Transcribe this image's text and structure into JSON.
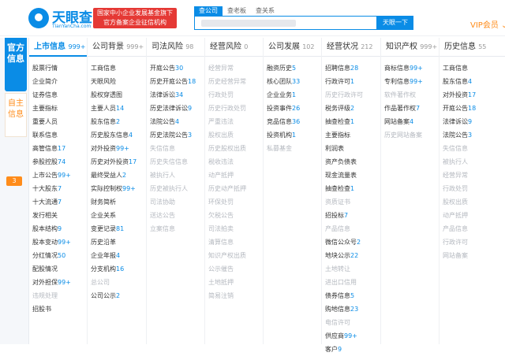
{
  "header": {
    "logo_text": "天眼查",
    "logo_sub": "TianYanCha.com",
    "badge_line1": "国家中小企业发展基金旗下",
    "badge_line2": "官方备案企业征信机构",
    "search_tabs": [
      "查公司",
      "查老板",
      "查关系"
    ],
    "search_button": "天眼一下",
    "vip": "VIP会员"
  },
  "sidebar": {
    "tab1": "官方信息",
    "tab2": "自主信息",
    "count": "3"
  },
  "columns": [
    {
      "title": "上市信息",
      "count": "999+",
      "items": [
        {
          "t": "股票行情",
          "c": "",
          "off": false
        },
        {
          "t": "企业简介",
          "c": "",
          "off": false
        },
        {
          "t": "证券信息",
          "c": "",
          "off": false
        },
        {
          "t": "主要指标",
          "c": "",
          "off": false
        },
        {
          "t": "重要人员",
          "c": "",
          "off": false
        },
        {
          "t": "联系信息",
          "c": "",
          "off": false
        },
        {
          "t": "高管信息",
          "c": "17",
          "off": false
        },
        {
          "t": "参股控股",
          "c": "74",
          "off": false
        },
        {
          "t": "上市公告",
          "c": "99+",
          "off": false
        },
        {
          "t": "十大股东",
          "c": "7",
          "off": false
        },
        {
          "t": "十大流通",
          "c": "7",
          "off": false
        },
        {
          "t": "发行相关",
          "c": "",
          "off": false
        },
        {
          "t": "股本结构",
          "c": "9",
          "off": false
        },
        {
          "t": "股本变动",
          "c": "99+",
          "off": false
        },
        {
          "t": "分红情况",
          "c": "50",
          "off": false
        },
        {
          "t": "配股情况",
          "c": "",
          "off": false
        },
        {
          "t": "对外担保",
          "c": "99+",
          "off": false
        },
        {
          "t": "违规处理",
          "c": "",
          "off": true
        },
        {
          "t": "招股书",
          "c": "",
          "off": false
        }
      ]
    },
    {
      "title": "公司背景",
      "count": "999+",
      "items": [
        {
          "t": "工商信息",
          "c": "",
          "off": false
        },
        {
          "t": "天眼风险",
          "c": "",
          "off": false
        },
        {
          "t": "股权穿透图",
          "c": "",
          "off": false
        },
        {
          "t": "主要人员",
          "c": "14",
          "off": false
        },
        {
          "t": "股东信息",
          "c": "2",
          "off": false
        },
        {
          "t": "历史股东信息",
          "c": "4",
          "off": false
        },
        {
          "t": "对外投资",
          "c": "99+",
          "off": false
        },
        {
          "t": "历史对外投资",
          "c": "17",
          "off": false
        },
        {
          "t": "最终受益人",
          "c": "2",
          "off": false
        },
        {
          "t": "实际控制权",
          "c": "99+",
          "off": false
        },
        {
          "t": "财务简析",
          "c": "",
          "off": false
        },
        {
          "t": "企业关系",
          "c": "",
          "off": false
        },
        {
          "t": "变更记录",
          "c": "81",
          "off": false
        },
        {
          "t": "历史沿革",
          "c": "",
          "off": false
        },
        {
          "t": "企业年报",
          "c": "4",
          "off": false
        },
        {
          "t": "分支机构",
          "c": "16",
          "off": false
        },
        {
          "t": "总公司",
          "c": "",
          "off": true
        },
        {
          "t": "公司公示",
          "c": "2",
          "off": false
        }
      ]
    },
    {
      "title": "司法风险",
      "count": "98",
      "items": [
        {
          "t": "开庭公告",
          "c": "30",
          "off": false
        },
        {
          "t": "历史开庭公告",
          "c": "18",
          "off": false
        },
        {
          "t": "法律诉讼",
          "c": "34",
          "off": false
        },
        {
          "t": "历史法律诉讼",
          "c": "9",
          "off": false
        },
        {
          "t": "法院公告",
          "c": "4",
          "off": false
        },
        {
          "t": "历史法院公告",
          "c": "3",
          "off": false
        },
        {
          "t": "失信信息",
          "c": "",
          "off": true
        },
        {
          "t": "历史失信信息",
          "c": "",
          "off": true
        },
        {
          "t": "被执行人",
          "c": "",
          "off": true
        },
        {
          "t": "历史被执行人",
          "c": "",
          "off": true
        },
        {
          "t": "司法协助",
          "c": "",
          "off": true
        },
        {
          "t": "送达公告",
          "c": "",
          "off": true
        },
        {
          "t": "立案信息",
          "c": "",
          "off": true
        }
      ]
    },
    {
      "title": "经营风险",
      "count": "0",
      "items": [
        {
          "t": "经营异常",
          "c": "",
          "off": true
        },
        {
          "t": "历史经营异常",
          "c": "",
          "off": true
        },
        {
          "t": "行政处罚",
          "c": "",
          "off": true
        },
        {
          "t": "历史行政处罚",
          "c": "",
          "off": true
        },
        {
          "t": "严重违法",
          "c": "",
          "off": true
        },
        {
          "t": "股权出质",
          "c": "",
          "off": true
        },
        {
          "t": "历史股权出质",
          "c": "",
          "off": true
        },
        {
          "t": "税收违法",
          "c": "",
          "off": true
        },
        {
          "t": "动产抵押",
          "c": "",
          "off": true
        },
        {
          "t": "历史动产抵押",
          "c": "",
          "off": true
        },
        {
          "t": "环保处罚",
          "c": "",
          "off": true
        },
        {
          "t": "欠税公告",
          "c": "",
          "off": true
        },
        {
          "t": "司法拍卖",
          "c": "",
          "off": true
        },
        {
          "t": "清算信息",
          "c": "",
          "off": true
        },
        {
          "t": "知识产权出质",
          "c": "",
          "off": true
        },
        {
          "t": "公示催告",
          "c": "",
          "off": true
        },
        {
          "t": "土地抵押",
          "c": "",
          "off": true
        },
        {
          "t": "简易注销",
          "c": "",
          "off": true
        }
      ]
    },
    {
      "title": "公司发展",
      "count": "102",
      "items": [
        {
          "t": "融资历史",
          "c": "5",
          "off": false
        },
        {
          "t": "核心团队",
          "c": "33",
          "off": false
        },
        {
          "t": "企业业务",
          "c": "1",
          "off": false
        },
        {
          "t": "投资事件",
          "c": "26",
          "off": false
        },
        {
          "t": "竞品信息",
          "c": "36",
          "off": false
        },
        {
          "t": "投资机构",
          "c": "1",
          "off": false
        },
        {
          "t": "私募基金",
          "c": "",
          "off": true
        }
      ]
    },
    {
      "title": "经营状况",
      "count": "212",
      "items": [
        {
          "t": "招聘信息",
          "c": "28",
          "off": false
        },
        {
          "t": "行政许可",
          "c": "1",
          "off": false
        },
        {
          "t": "历史行政许可",
          "c": "",
          "off": true
        },
        {
          "t": "税务评级",
          "c": "2",
          "off": false
        },
        {
          "t": "抽查检查",
          "c": "1",
          "off": false
        },
        {
          "t": "主要指标",
          "c": "",
          "off": false
        },
        {
          "t": "利润表",
          "c": "",
          "off": false
        },
        {
          "t": "资产负债表",
          "c": "",
          "off": false
        },
        {
          "t": "现金流量表",
          "c": "",
          "off": false
        },
        {
          "t": "抽查检查",
          "c": "1",
          "off": false
        },
        {
          "t": "资质证书",
          "c": "",
          "off": true
        },
        {
          "t": "招投标",
          "c": "7",
          "off": false
        },
        {
          "t": "产品信息",
          "c": "",
          "off": true
        },
        {
          "t": "微信公众号",
          "c": "2",
          "off": false
        },
        {
          "t": "地块公示",
          "c": "22",
          "off": false
        },
        {
          "t": "土地转让",
          "c": "",
          "off": true
        },
        {
          "t": "进出口信用",
          "c": "",
          "off": true
        },
        {
          "t": "债券信息",
          "c": "5",
          "off": false
        },
        {
          "t": "购地信息",
          "c": "23",
          "off": false
        },
        {
          "t": "电信许可",
          "c": "",
          "off": true
        },
        {
          "t": "供应商",
          "c": "99+",
          "off": false
        },
        {
          "t": "客户",
          "c": "9",
          "off": false
        }
      ]
    },
    {
      "title": "知识产权",
      "count": "999+",
      "items": [
        {
          "t": "商标信息",
          "c": "99+",
          "off": false
        },
        {
          "t": "专利信息",
          "c": "99+",
          "off": false
        },
        {
          "t": "软件著作权",
          "c": "",
          "off": true
        },
        {
          "t": "作品著作权",
          "c": "7",
          "off": false
        },
        {
          "t": "网站备案",
          "c": "4",
          "off": false
        },
        {
          "t": "历史网站备案",
          "c": "",
          "off": true
        }
      ]
    },
    {
      "title": "历史信息",
      "count": "55",
      "items": [
        {
          "t": "工商信息",
          "c": "",
          "off": false
        },
        {
          "t": "股东信息",
          "c": "4",
          "off": false
        },
        {
          "t": "对外投资",
          "c": "17",
          "off": false
        },
        {
          "t": "开庭公告",
          "c": "18",
          "off": false
        },
        {
          "t": "法律诉讼",
          "c": "9",
          "off": false
        },
        {
          "t": "法院公告",
          "c": "3",
          "off": false
        },
        {
          "t": "失信信息",
          "c": "",
          "off": true
        },
        {
          "t": "被执行人",
          "c": "",
          "off": true
        },
        {
          "t": "经营异常",
          "c": "",
          "off": true
        },
        {
          "t": "行政处罚",
          "c": "",
          "off": true
        },
        {
          "t": "股权出质",
          "c": "",
          "off": true
        },
        {
          "t": "动产抵押",
          "c": "",
          "off": true
        },
        {
          "t": "产品信息",
          "c": "",
          "off": true
        },
        {
          "t": "行政许可",
          "c": "",
          "off": true
        },
        {
          "t": "网站备案",
          "c": "",
          "off": true
        }
      ]
    }
  ]
}
